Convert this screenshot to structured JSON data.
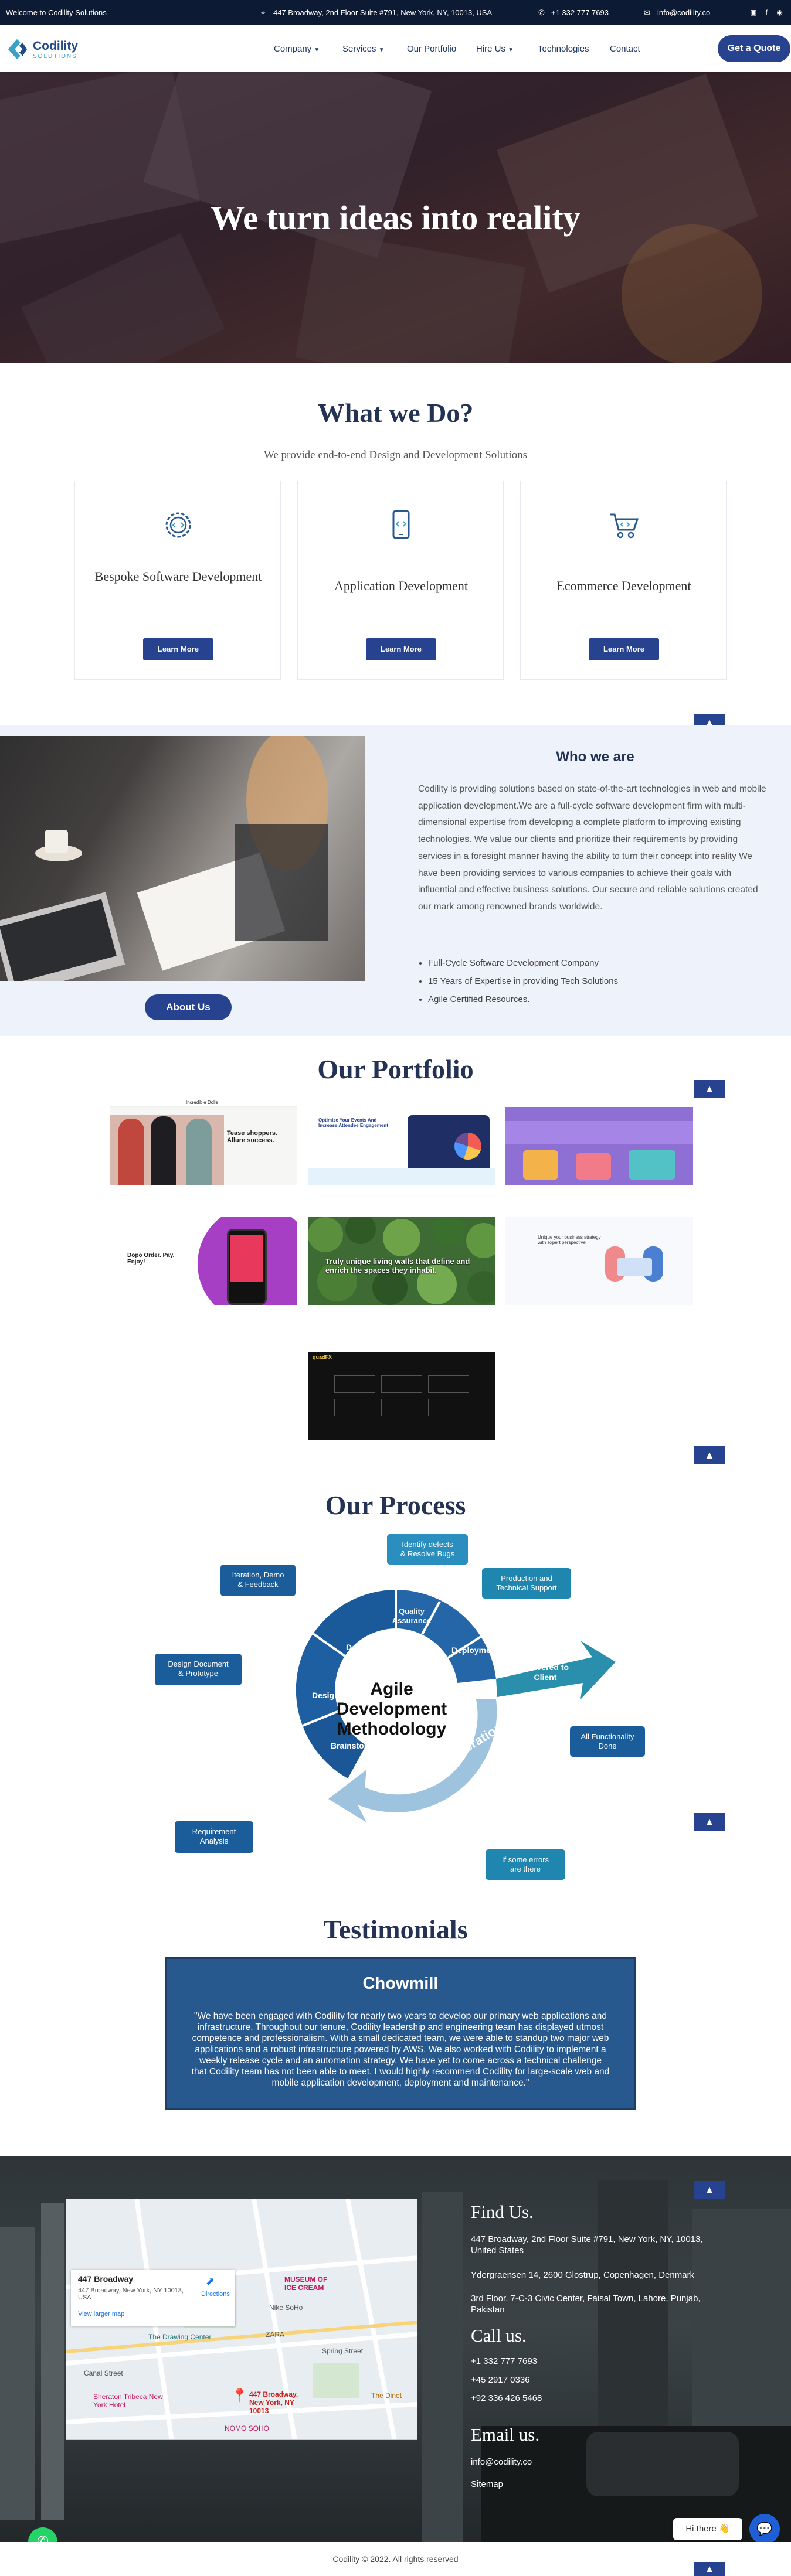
{
  "topbar": {
    "welcome": "Welcome to Codility Solutions",
    "address": "447 Broadway, 2nd Floor Suite #791, New York, NY, 10013, USA",
    "phone": "+1 332 777 7693",
    "email": "info@codility.co"
  },
  "brand": {
    "name": "Codility",
    "tagline": "SOLUTIONS"
  },
  "nav": {
    "items": [
      "Company",
      "Services",
      "Our Portfolio",
      "Hire Us",
      "Technologies",
      "Contact"
    ],
    "quote": "Get a Quote"
  },
  "hero": {
    "title": "We turn ideas into reality"
  },
  "services": {
    "title": "What we Do?",
    "subtitle": "We provide end-to-end Design and Development Solutions",
    "cards": [
      {
        "title": "Bespoke Software Development",
        "button": "Learn More",
        "icon": "gear-code-icon"
      },
      {
        "title": "Application Development",
        "button": "Learn More",
        "icon": "mobile-code-icon"
      },
      {
        "title": "Ecommerce Development",
        "button": "Learn More",
        "icon": "cart-icon"
      }
    ]
  },
  "who": {
    "title": "Who we are",
    "body": "Codility is providing solutions based on state-of-the-art technologies in web and mobile application development.We are a full-cycle software development firm with multi-dimensional expertise from developing a complete platform to improving existing technologies. We value our clients and prioritize their requirements by providing services in a foresight manner having the ability to turn their concept into reality We have been providing services to various companies to achieve their goals with influential and effective business solutions. Our secure and reliable solutions created our mark among renowned brands worldwide.",
    "bullets": [
      "Full-Cycle Software Development Company",
      "15 Years of Expertise in providing Tech Solutions",
      "Agile Certified Resources."
    ],
    "button": "About Us"
  },
  "portfolio": {
    "title": "Our Portfolio",
    "thumbs": {
      "t1": {
        "brand": "Incredible Dolls",
        "headline": "Tease shoppers. Allure success."
      },
      "t2": {
        "headline": "Optimize Your Events And Increase Attendee Engagement"
      },
      "t4": {
        "headline": "Dopo Order. Pay. Enjoy!"
      },
      "t5": {
        "headline": "Truly unique living walls that define and enrich the spaces they inhabit."
      },
      "t6": {
        "headline": "Unique your business strategy with expert perspective"
      },
      "t7": {
        "brand": "quadFX"
      }
    }
  },
  "process": {
    "title": "Our Process",
    "center": [
      "Agile",
      "Development",
      "Methodology"
    ],
    "segments": [
      "Quality Assurance",
      "Deployment",
      "Development",
      "Design",
      "Brainstorm"
    ],
    "arrow": "Delivered to Client",
    "iteration": "Next Iteration",
    "callouts": [
      "Identify defects & Resolve Bugs",
      "Production and Technical Support",
      "Iteration, Demo & Feedback",
      "Design Document & Prototype",
      "All Functionality Done",
      "Requirement Analysis",
      "If some errors are there"
    ]
  },
  "testimonials": {
    "title": "Testimonials",
    "name": "Chowmill",
    "quote": "\"We have been engaged with Codility for nearly two years to develop our primary web applications and infrastructure. Throughout our tenure, Codility leadership and engineering team has displayed utmost competence and professionalism. With a small dedicated team, we were able to standup two major web applications and a robust infrastructure powered by AWS. We also worked with Codility to implement a weekly release cycle and an automation strategy. We have yet to come across a technical challenge that Codility team has not been able to meet. I would highly recommend Codility for large-scale web and mobile application development, deployment and maintenance.\""
  },
  "map": {
    "title": "447 Broadway",
    "address": "447 Broadway, New York, NY 10013, USA",
    "directions": "Directions",
    "larger": "View larger map",
    "pin": "447 Broadway, New York, NY 10013",
    "labels": [
      "MUSEUM OF ICE CREAM",
      "Nike SoHo",
      "The Drawing Center",
      "ZARA",
      "Canal Street",
      "Spring Street",
      "Sheraton Tribeca New York Hotel",
      "The Dinet",
      "NOMO SOHO"
    ]
  },
  "footer": {
    "find": "Find Us.",
    "addr1": "447 Broadway, 2nd Floor Suite #791, New York, NY, 10013, United States",
    "addr2": "Ydergraensen 14, 2600 Glostrup, Copenhagen, Denmark",
    "addr3": "3rd Floor, 7-C-3 Civic Center, Faisal Town, Lahore, Punjab, Pakistan",
    "call": "Call us.",
    "phone1": "+1 332 777 7693",
    "phone2": "+45 2917 0336",
    "phone3": "+92 336 426 5468",
    "emailh": "Email us.",
    "email": "info@codility.co",
    "sitemap": "Sitemap",
    "chat": "Hi there 👋",
    "copyright": "Codility © 2022. All rights reserved"
  },
  "colors": {
    "navy": "#0c1a33",
    "primary": "#27428f",
    "heading": "#243354",
    "accent": "#3aa1c9"
  }
}
